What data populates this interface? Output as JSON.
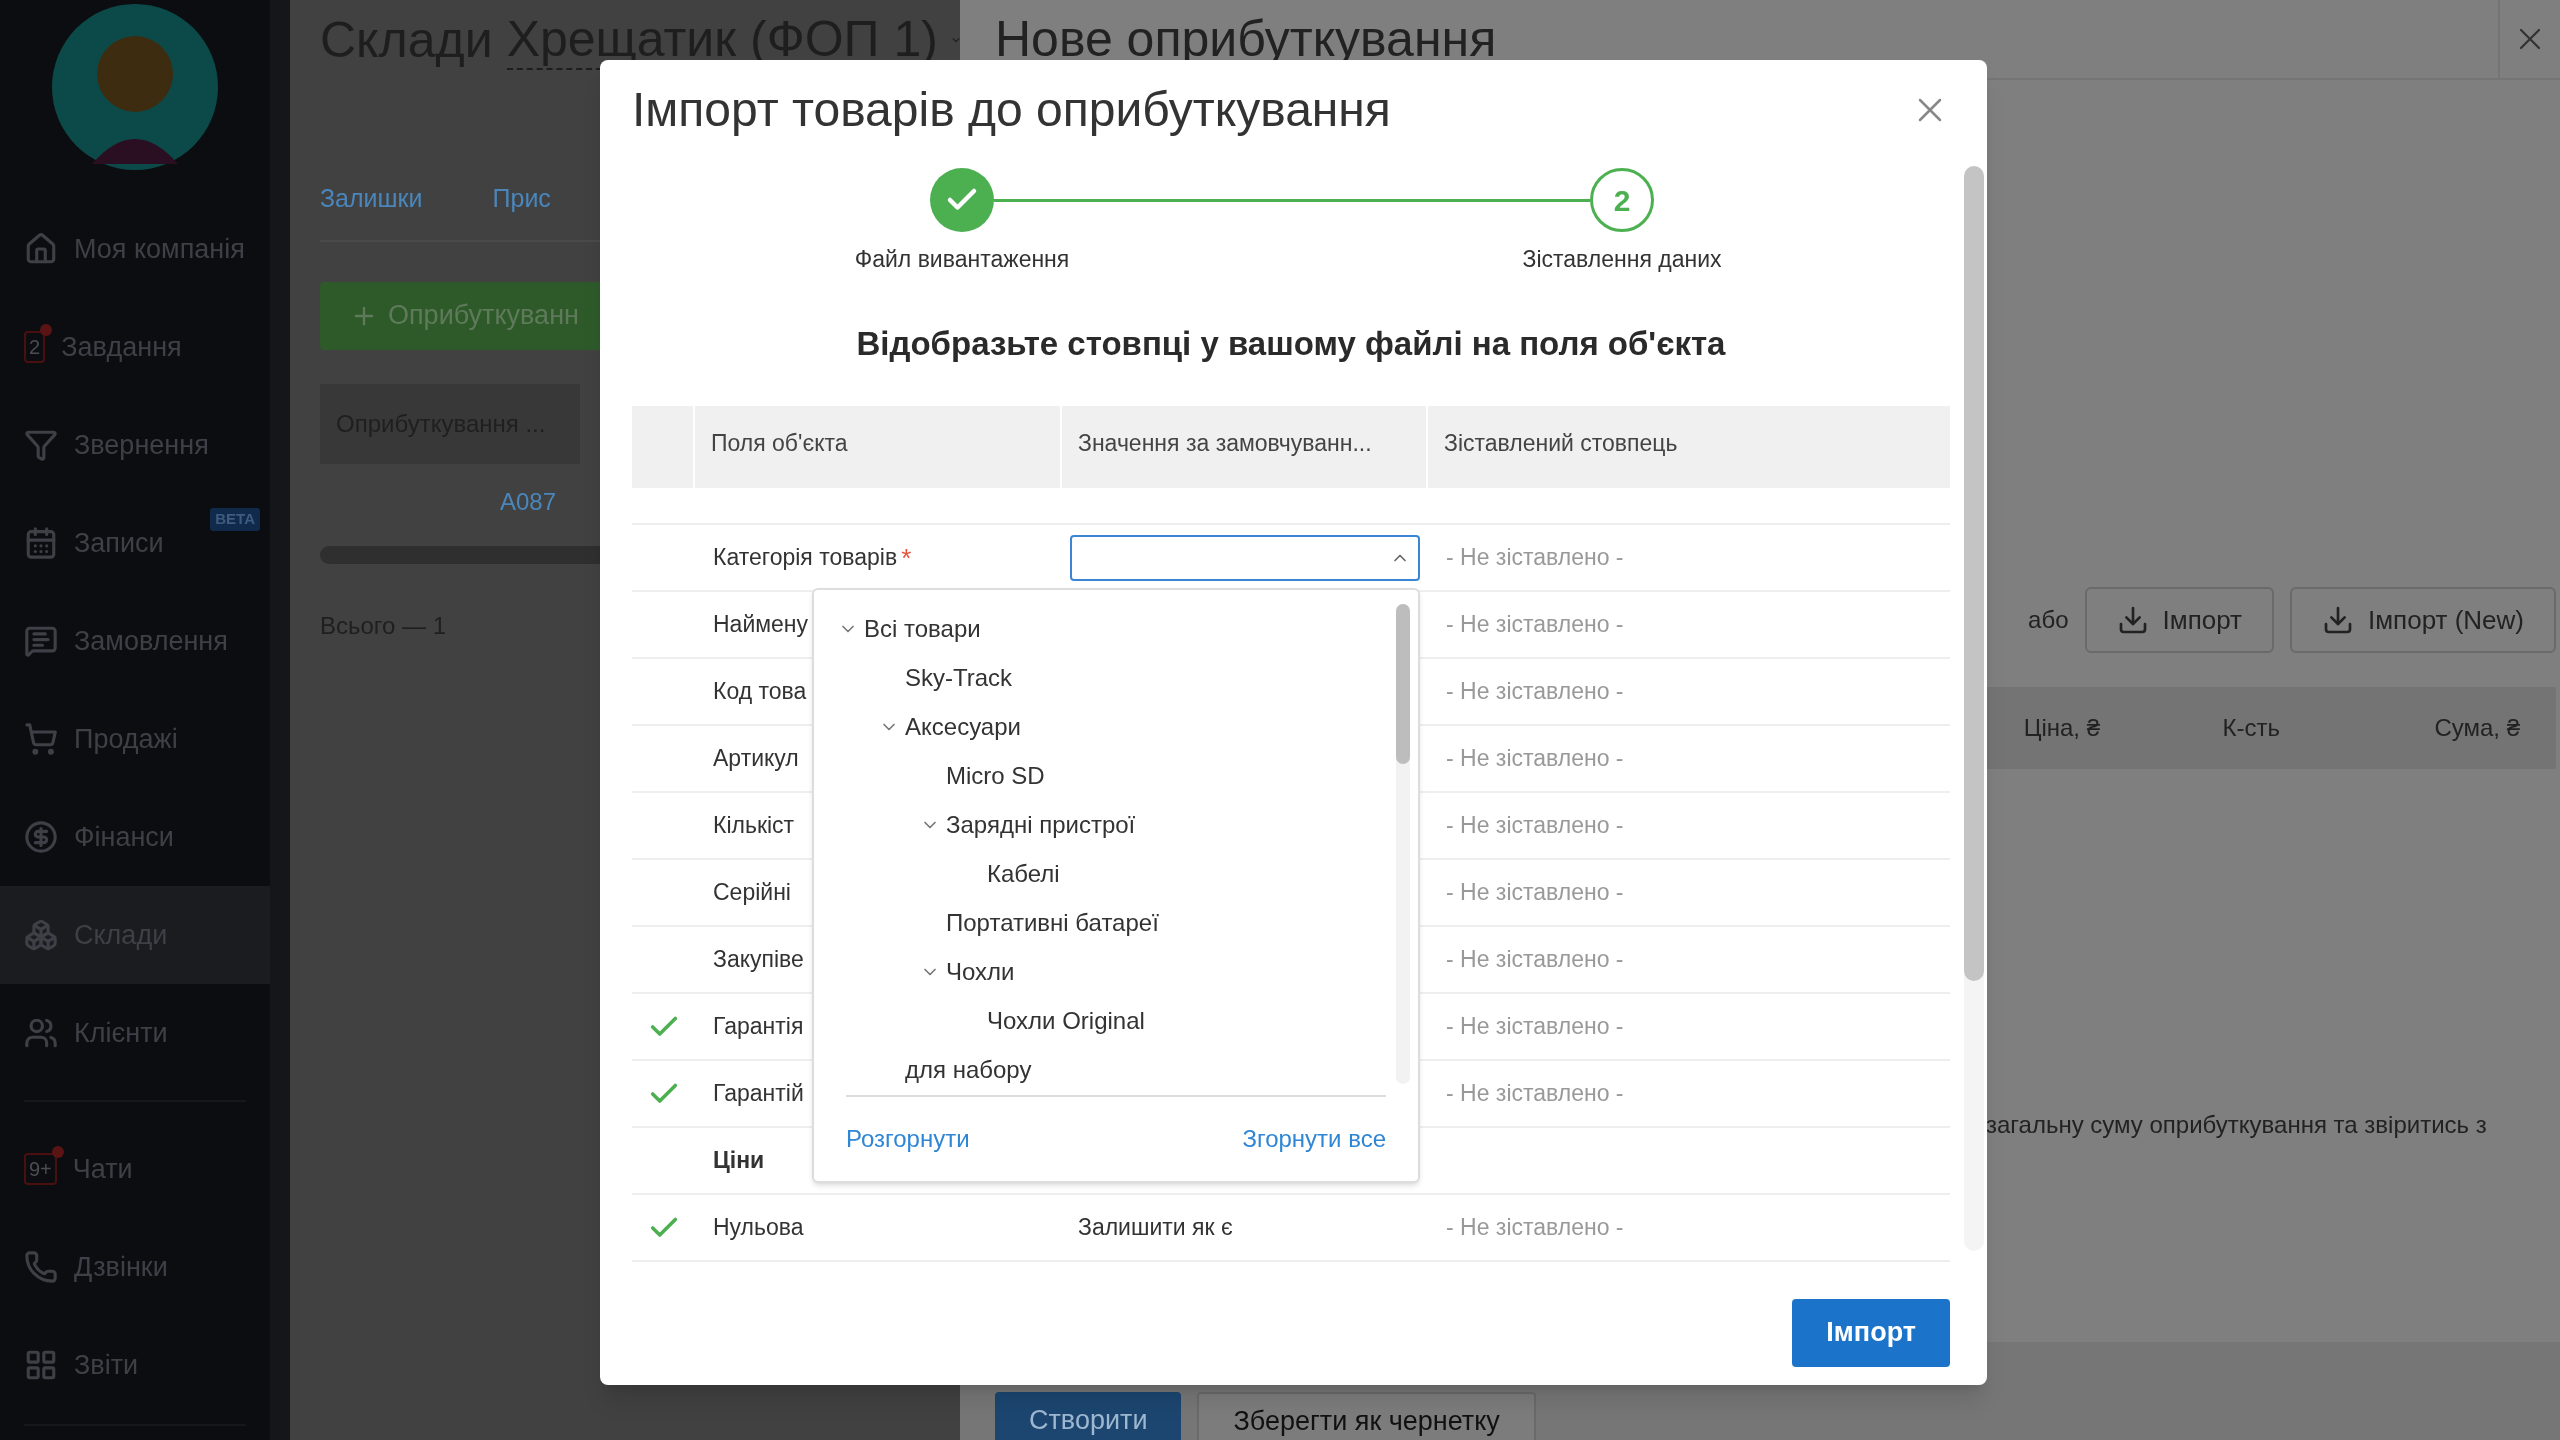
{
  "sidebar": {
    "items": [
      {
        "label": "Моя компанія",
        "selected": false
      },
      {
        "label": "Завдання",
        "badge": "2",
        "selected": false
      },
      {
        "label": "Звернення",
        "selected": false
      },
      {
        "label": "Записи",
        "tag": "BETA",
        "selected": false
      },
      {
        "label": "Замовлення",
        "selected": false
      },
      {
        "label": "Продажі",
        "selected": false
      },
      {
        "label": "Фінанси",
        "selected": false
      },
      {
        "label": "Склади",
        "selected": true
      },
      {
        "label": "Клієнти",
        "selected": false
      },
      {
        "label": "Чати",
        "badge": "9+",
        "selected": false
      },
      {
        "label": "Дзвінки",
        "selected": false
      },
      {
        "label": "Звіти",
        "selected": false
      }
    ]
  },
  "warehouse": {
    "section": "Склади",
    "store": "Хрещатик (ФОП 1)",
    "tabs": [
      "Залишки",
      "Прис"
    ],
    "add_button": "Оприбуткуванн",
    "column": "Оприбуткування ...",
    "cell": "A087",
    "total": "Всього — 1"
  },
  "document": {
    "title": "Нове оприбуткування",
    "or": "або",
    "import_buttons": [
      "Імпорт",
      "Імпорт (New)"
    ],
    "columns": [
      "Ціна, ₴",
      "К-сть",
      "Сума, ₴"
    ],
    "note": "загальну суму оприбуткування та звіритись з",
    "actions": [
      "Створити",
      "Зберегти як чернетку"
    ]
  },
  "modal": {
    "title": "Імпорт товарів до оприбуткування",
    "steps": [
      {
        "label": "Файл вивантаження",
        "done": true
      },
      {
        "label": "Зіставлення даних",
        "number": "2",
        "done": false
      }
    ],
    "heading": "Відобразьте стовпці у вашому файлі на поля об'єкта",
    "columns": [
      "Поля об'єкта",
      "Значення за замовчуванн...",
      "Зіставлений стовпець"
    ],
    "rows": [
      {
        "kind": "select",
        "field": "Категорія товарів",
        "required_mark": "*",
        "checked": false,
        "mapped": "- Не зіставлено -"
      },
      {
        "kind": "field",
        "field": "Наймену",
        "checked": false,
        "mapped": "- Не зіставлено -"
      },
      {
        "kind": "field",
        "field": "Код това",
        "checked": false,
        "mapped": "- Не зіставлено -"
      },
      {
        "kind": "field",
        "field": "Артикул",
        "checked": false,
        "mapped": "- Не зіставлено -"
      },
      {
        "kind": "field",
        "field": "Кількіст",
        "checked": false,
        "mapped": "- Не зіставлено -"
      },
      {
        "kind": "field",
        "field": "Серійні",
        "checked": false,
        "mapped": "- Не зіставлено -"
      },
      {
        "kind": "field",
        "field": "Закупіве",
        "checked": false,
        "mapped": "- Не зіставлено -"
      },
      {
        "kind": "field",
        "field": "Гарантія",
        "checked": true,
        "mapped": "- Не зіставлено -"
      },
      {
        "kind": "field",
        "field": "Гарантій",
        "checked": true,
        "mapped": "- Не зіставлено -"
      },
      {
        "kind": "section",
        "field": "Ціни"
      },
      {
        "kind": "field",
        "field": "Нульова",
        "checked": true,
        "default": "Залишити як є",
        "mapped": "- Не зіставлено -"
      }
    ],
    "dropdown": {
      "tree": [
        {
          "label": "Всі товари",
          "expanded": true,
          "children": [
            {
              "label": "Sky-Track"
            },
            {
              "label": "Аксесуари",
              "expanded": true,
              "children": [
                {
                  "label": "Micro SD"
                },
                {
                  "label": "Зарядні пристрої",
                  "expanded": true,
                  "children": [
                    {
                      "label": "Кабелі"
                    }
                  ]
                },
                {
                  "label": "Портативні батареї"
                },
                {
                  "label": "Чохли",
                  "expanded": true,
                  "children": [
                    {
                      "label": "Чохли Original"
                    }
                  ]
                }
              ]
            },
            {
              "label": "для набору"
            }
          ]
        }
      ],
      "expand": "Розгорнути",
      "collapse_all": "Згорнути все"
    },
    "import_button": "Імпорт"
  }
}
